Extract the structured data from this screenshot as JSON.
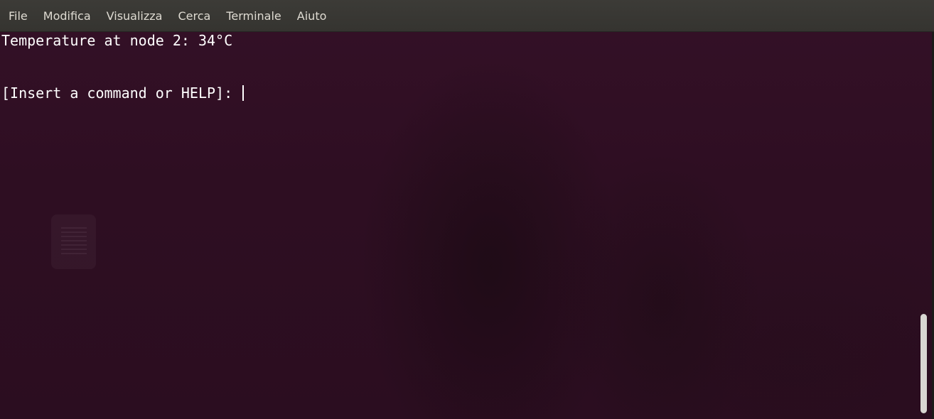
{
  "menubar": {
    "items": [
      {
        "label": "File"
      },
      {
        "label": "Modifica"
      },
      {
        "label": "Visualizza"
      },
      {
        "label": "Cerca"
      },
      {
        "label": "Terminale"
      },
      {
        "label": "Aiuto"
      }
    ]
  },
  "terminal": {
    "lines": [
      "Temperature at node 2: 34°C",
      "[Insert a command or HELP]: "
    ],
    "background_color": "#2e0e22",
    "text_color": "#ffffff"
  }
}
